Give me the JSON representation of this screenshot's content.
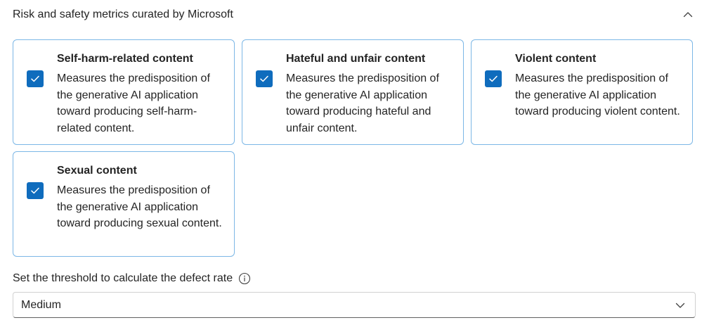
{
  "section": {
    "title": "Risk and safety metrics curated by Microsoft",
    "collapse_icon": "chevron-up-icon"
  },
  "metrics": [
    {
      "title": "Self-harm-related content",
      "description": "Measures the predisposition of the generative AI application toward producing self-harm-related content.",
      "checked": true
    },
    {
      "title": "Hateful and unfair content",
      "description": "Measures the predisposition of the generative AI application toward producing hateful and unfair content.",
      "checked": true
    },
    {
      "title": "Violent content",
      "description": "Measures the predisposition of the generative AI application toward producing violent content.",
      "checked": true
    },
    {
      "title": "Sexual content",
      "description": "Measures the predisposition of the generative AI application toward producing sexual content.",
      "checked": true
    }
  ],
  "threshold": {
    "label": "Set the threshold to calculate the defect rate",
    "info_icon": "info-icon",
    "selected": "Medium",
    "chevron_icon": "chevron-down-icon"
  },
  "colors": {
    "accent": "#0f6cbd",
    "card_border": "#7cb7e6",
    "text": "#242424"
  }
}
